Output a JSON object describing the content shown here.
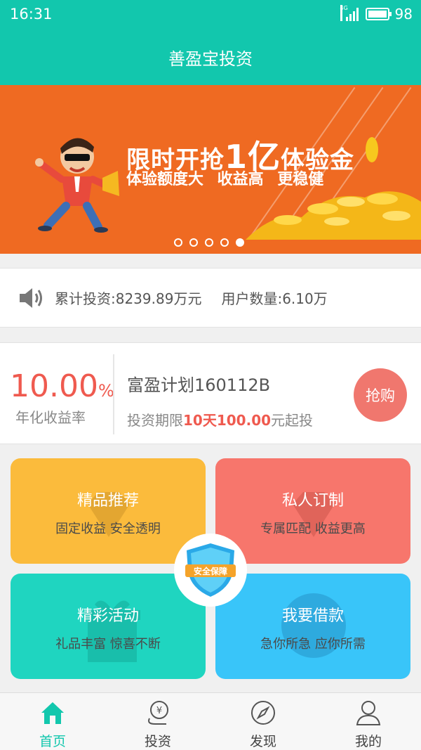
{
  "status": {
    "time": "16:31",
    "network": "4G",
    "battery": "98"
  },
  "header": {
    "title": "善盈宝投资"
  },
  "banner": {
    "headline_pre": "限时开抢",
    "headline_num": "1亿",
    "headline_post": "体验金",
    "subline": "体验额度大 收益高 更稳健",
    "pages": 5,
    "active_page": 5
  },
  "stats": {
    "total_invest": "累计投资:8239.89万元",
    "user_count": "用户数量:6.10万"
  },
  "product": {
    "rate_value": "10.00",
    "rate_unit": "%",
    "rate_label": "年化收益率",
    "name": "富盈计划160112B",
    "term_prefix": "投资期限",
    "term_days": "10天",
    "min_amount": "100.00",
    "term_suffix": "元起投",
    "buy_label": "抢购"
  },
  "tiles": [
    {
      "title": "精品推荐",
      "subtitle": "固定收益 安全透明",
      "color": "#fbbb3c"
    },
    {
      "title": "私人订制",
      "subtitle": "专属匹配 收益更高",
      "color": "#f7766c"
    },
    {
      "title": "精彩活动",
      "subtitle": "礼品丰富 惊喜不断",
      "color": "#1fd5c0"
    },
    {
      "title": "我要借款",
      "subtitle": "急你所急 应你所需",
      "color": "#39c5f9"
    }
  ],
  "badge": {
    "label": "安全保障"
  },
  "tabbar": [
    {
      "label": "首页",
      "icon": "home-icon",
      "active": true
    },
    {
      "label": "投资",
      "icon": "money-icon"
    },
    {
      "label": "发现",
      "icon": "compass-icon"
    },
    {
      "label": "我的",
      "icon": "user-icon"
    }
  ],
  "colors": {
    "brand": "#12c7ad",
    "banner": "#ef6a22",
    "accent_red": "#ef5a4f"
  }
}
